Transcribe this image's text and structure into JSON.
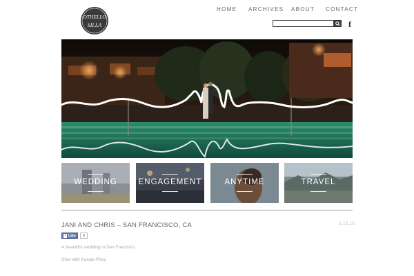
{
  "brand": {
    "logo_text_top": "OTHELLO",
    "logo_text_bottom": "SILLA"
  },
  "nav": {
    "items": [
      {
        "label": "HOME"
      },
      {
        "label": "ARCHIVES"
      },
      {
        "label": "ABOUT"
      },
      {
        "label": "CONTACT"
      }
    ]
  },
  "search": {
    "value": "",
    "placeholder": ""
  },
  "social": {
    "facebook_glyph": "f"
  },
  "categories": [
    {
      "label": "WEDDING"
    },
    {
      "label": "ENGAGEMENT"
    },
    {
      "label": "ANYTIME"
    },
    {
      "label": "TRAVEL"
    }
  ],
  "post": {
    "title": "JANI AND CHRIS – SAN FRANCISCO, CA",
    "date": "3.15.15",
    "like_label": "Like",
    "like_count": "0",
    "text_1": "A beautiful wedding in San Francisco",
    "text_2": "Shot with Kassia Phoy"
  },
  "colors": {
    "nav_text": "#666666",
    "fb_blue": "#5f78ab",
    "divider": "#999999"
  }
}
